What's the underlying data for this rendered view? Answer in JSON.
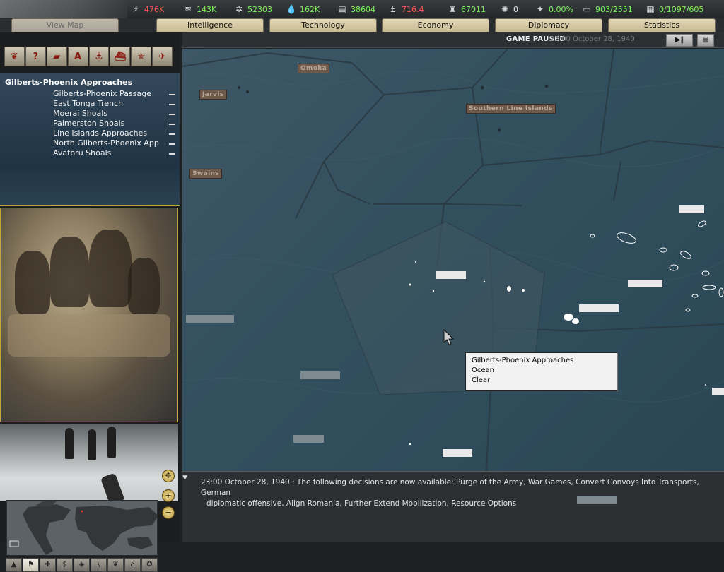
{
  "resources": [
    {
      "name": "energy",
      "icon": "lightning-icon",
      "glyph": "⚡",
      "value": "476K",
      "color": "red"
    },
    {
      "name": "metal",
      "icon": "metal-icon",
      "glyph": "≋",
      "value": "143K",
      "color": "green"
    },
    {
      "name": "rare-materials",
      "icon": "rare-materials-icon",
      "glyph": "✲",
      "value": "52303",
      "color": "green"
    },
    {
      "name": "oil",
      "icon": "oil-drop-icon",
      "glyph": "💧",
      "value": "162K",
      "color": "green"
    },
    {
      "name": "supplies",
      "icon": "supplies-icon",
      "glyph": "▤",
      "value": "38604",
      "color": "green"
    },
    {
      "name": "money",
      "icon": "pound-icon",
      "glyph": "£",
      "value": "716.4",
      "color": "red"
    },
    {
      "name": "manpower",
      "icon": "manpower-icon",
      "glyph": "♜",
      "value": "67011",
      "color": "green"
    },
    {
      "name": "nukes",
      "icon": "nuke-icon",
      "glyph": "✺",
      "value": "0",
      "color": "white"
    },
    {
      "name": "dissent",
      "icon": "dissent-icon",
      "glyph": "✦",
      "value": "0.00%",
      "color": "green"
    },
    {
      "name": "transports",
      "icon": "transport-icon",
      "glyph": "▭",
      "value": "903/2551",
      "color": "green"
    },
    {
      "name": "escorts",
      "icon": "escort-icon",
      "glyph": "▦",
      "value": "0/1097/605",
      "color": "green"
    }
  ],
  "tabs": [
    {
      "label": "View Map",
      "disabled": true
    },
    {
      "label": "Intelligence",
      "disabled": false
    },
    {
      "label": "Technology",
      "disabled": false
    },
    {
      "label": "Economy",
      "disabled": false
    },
    {
      "label": "Diplomacy",
      "disabled": false
    },
    {
      "label": "Statistics",
      "disabled": false
    }
  ],
  "status": {
    "paused_label": "GAME PAUSED",
    "date": "23:00 October 28, 1940",
    "play_pause_glyph": "▶‖",
    "menu_glyph": "▤"
  },
  "toolbar": [
    {
      "icon": "unit-icon",
      "glyph": "❦"
    },
    {
      "icon": "help-icon",
      "glyph": "?"
    },
    {
      "icon": "tank-icon",
      "glyph": "▰"
    },
    {
      "icon": "air-icon",
      "glyph": "A"
    },
    {
      "icon": "anchor-icon",
      "glyph": "⚓"
    },
    {
      "icon": "ship-icon",
      "glyph": "⛴"
    },
    {
      "icon": "star-icon",
      "glyph": "✯"
    },
    {
      "icon": "plane-icon",
      "glyph": "✈"
    }
  ],
  "area": {
    "title": "Gilberts-Phoenix Approaches",
    "items": [
      "Gilberts-Phoenix Passage",
      "East Tonga Trench",
      "Moerai Shoals",
      "Palmerston Shoals",
      "Line Islands Approaches",
      "North Gilberts-Phoenix App",
      "Avatoru Shoals"
    ]
  },
  "minimap_tools": [
    {
      "icon": "terrain-icon",
      "glyph": "▲"
    },
    {
      "icon": "political-icon",
      "glyph": "⚑"
    },
    {
      "icon": "supply-icon",
      "glyph": "✚"
    },
    {
      "icon": "economy-icon",
      "glyph": "$"
    },
    {
      "icon": "resource-icon",
      "glyph": "◈"
    },
    {
      "icon": "weather-icon",
      "glyph": "\\"
    },
    {
      "icon": "diplomacy-icon",
      "glyph": "❦"
    },
    {
      "icon": "buildings-icon",
      "glyph": "⌂"
    },
    {
      "icon": "settings-icon",
      "glyph": "✪"
    }
  ],
  "map": {
    "labels": [
      "Omoka",
      "Jarvis",
      "Southern Line Islands",
      "Swains"
    ],
    "tooltip": {
      "region": "Gilberts-Phoenix Approaches",
      "terrain": "Ocean",
      "weather": "Clear"
    }
  },
  "message": {
    "line1": "23:00 October 28, 1940 : The following decisions are now available: Purge of the Army, War Games, Convert Convoys Into Transports, German",
    "line2": "diplomatic offensive, Align Romania, Further Extend Mobilization, Resource Options"
  }
}
